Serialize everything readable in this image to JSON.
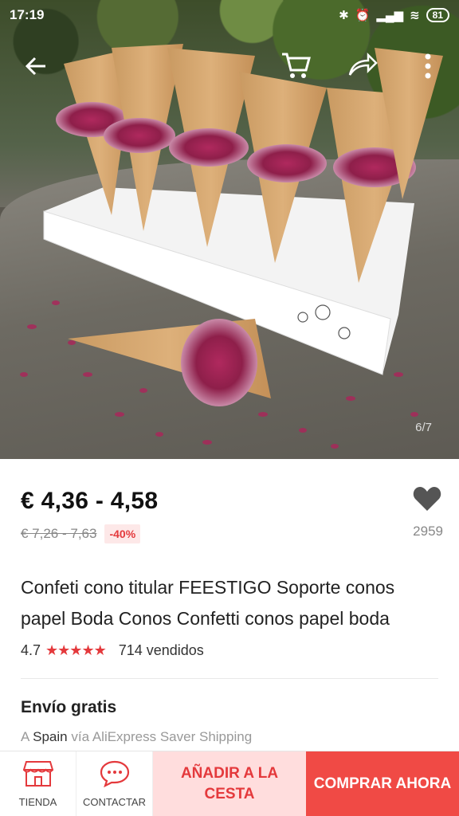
{
  "status_bar": {
    "time": "17:19",
    "battery": "81"
  },
  "gallery": {
    "counter": "6/7"
  },
  "product": {
    "price": "€ 4,36 - 4,58",
    "original_price": "€ 7,26 - 7,63",
    "discount": "-40%",
    "wishlist_count": "2959",
    "title": "Confeti cono titular FEESTIGO Soporte conos papel Boda Conos Confetti conos papel boda",
    "rating": "4.7",
    "stars": "★★★★★",
    "sold": "714 vendidos"
  },
  "shipping": {
    "title": "Envío gratis",
    "prefix": "A",
    "destination": "Spain",
    "method": "vía AliExpress Saver Shipping"
  },
  "bottom_bar": {
    "store_label": "TIENDA",
    "contact_label": "CONTACTAR",
    "add_to_cart_label": "AÑADIR A LA CESTA",
    "buy_now_label": "COMPRAR AHORA"
  },
  "colors": {
    "accent": "#e4393c",
    "buy_now_bg": "#f04a45",
    "add_to_cart_bg": "#fdd"
  },
  "icons": {
    "back": "arrow-left-icon",
    "cart": "cart-icon",
    "share": "share-icon",
    "more": "more-vertical-icon",
    "wishlist": "heart-icon",
    "store": "store-icon",
    "contact": "chat-icon"
  }
}
